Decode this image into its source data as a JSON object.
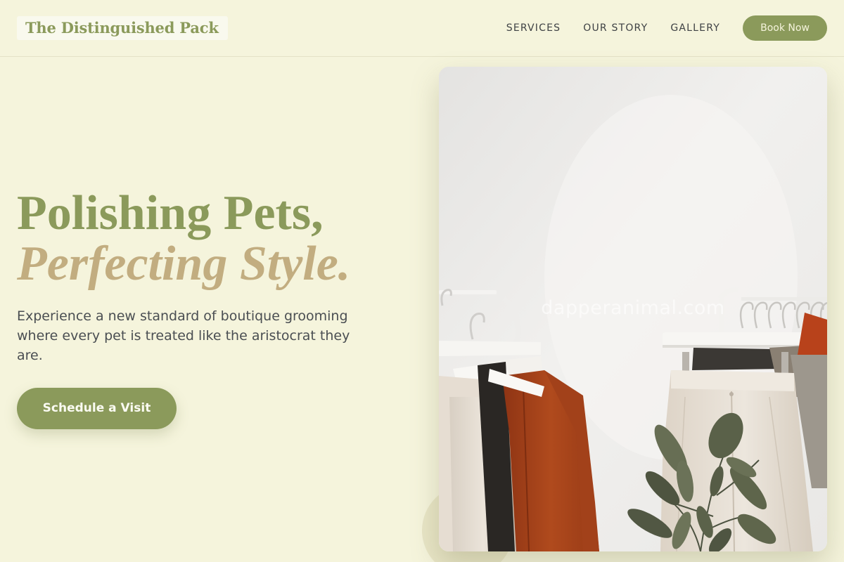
{
  "header": {
    "brand": "The Distinguished Pack",
    "nav": {
      "services": "SERVICES",
      "story": "OUR STORY",
      "gallery": "GALLERY"
    },
    "book_button": "Book Now"
  },
  "hero": {
    "title_line1": "Polishing Pets,",
    "title_line2": "Perfecting Style.",
    "description": "Experience a new standard of boutique grooming where every pet is treated like the aristocrat they are.",
    "cta": "Schedule a Visit"
  },
  "image": {
    "watermark": "dapperanimal.com"
  },
  "colors": {
    "background": "#f5f4dc",
    "accent": "#8b9a5b",
    "gold": "#c2ad80",
    "text": "#3f4346"
  }
}
